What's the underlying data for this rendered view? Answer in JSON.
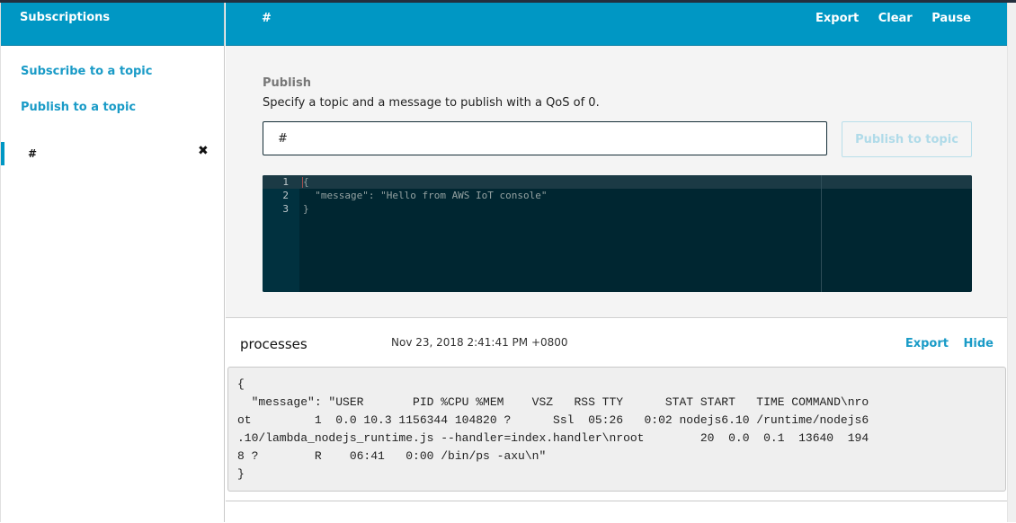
{
  "sidebar": {
    "title": "Subscriptions",
    "links": [
      {
        "label": "Subscribe to a topic"
      },
      {
        "label": "Publish to a topic"
      }
    ],
    "subscriptions": [
      {
        "topic": "#",
        "remove_icon": "close-icon",
        "remove_glyph": "✖"
      }
    ]
  },
  "header": {
    "topic": "#",
    "actions": [
      {
        "label": "Export"
      },
      {
        "label": "Clear"
      },
      {
        "label": "Pause"
      }
    ]
  },
  "publish": {
    "label": "Publish",
    "description": "Specify a topic and a message to publish with a QoS of 0.",
    "topic_value": "#",
    "button_label": "Publish to topic",
    "editor": {
      "line_numbers": [
        "1",
        "2",
        "3"
      ],
      "lines": [
        "{",
        "  \"message\": \"Hello from AWS IoT console\"",
        "}"
      ]
    }
  },
  "messages": [
    {
      "topic": "processes",
      "timestamp": "Nov 23, 2018 2:41:41 PM +0800",
      "actions": [
        {
          "label": "Export"
        },
        {
          "label": "Hide"
        }
      ],
      "body": "{\n  \"message\": \"USER       PID %CPU %MEM    VSZ   RSS TTY      STAT START   TIME COMMAND\\nro\not         1  0.0 10.3 1156344 104820 ?      Ssl  05:26   0:02 nodejs6.10 /runtime/nodejs6\n.10/lambda_nodejs_runtime.js --handler=index.handler\\nroot        20  0.0  0.1  13640  194\n8 ?        R    06:41   0:00 /bin/ps -axu\\n\"\n}"
    }
  ],
  "colors": {
    "accent": "#0097c4",
    "link": "#1a9bc7",
    "editor_bg": "#002631"
  }
}
